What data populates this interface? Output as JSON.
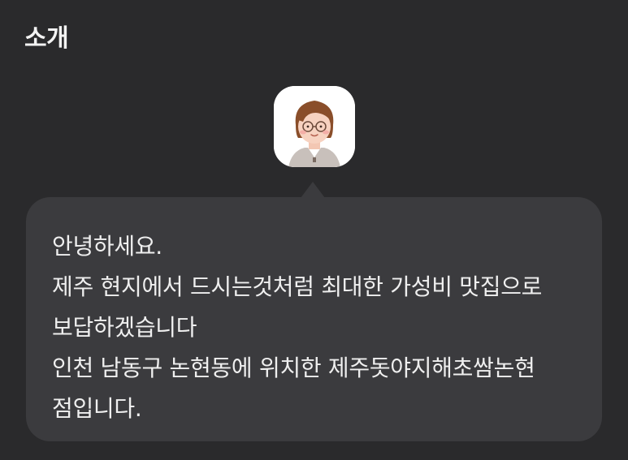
{
  "section": {
    "title": "소개"
  },
  "avatar": {
    "icon": "avatar-illustration",
    "alt": "profile avatar"
  },
  "bubble": {
    "lines": [
      "안녕하세요.",
      "제주 현지에서 드시는것처럼 최대한 가성비 맛집으로",
      "보답하겠습니다",
      "인천 남동구 논현동에 위치한 제주돗야지해초쌈논현",
      "점입니다."
    ]
  },
  "colors": {
    "background": "#2a2a2c",
    "bubble": "#3b3b3e",
    "text": "#efefef"
  }
}
